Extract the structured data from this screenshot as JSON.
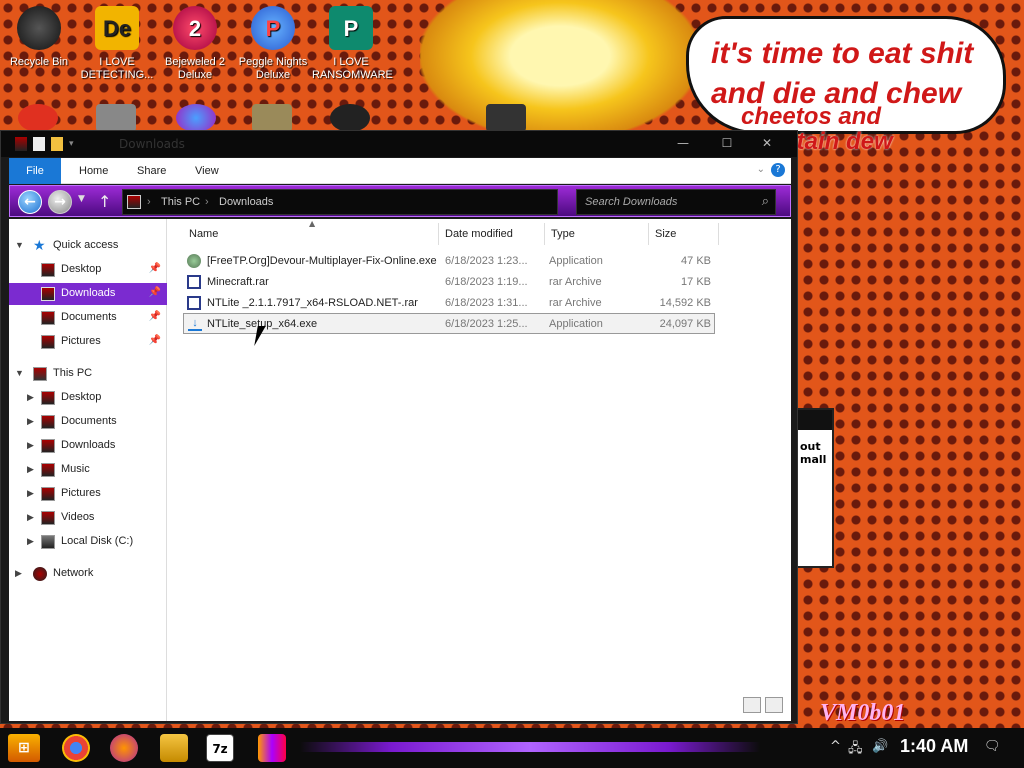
{
  "desktop": {
    "icons": [
      {
        "label": "Recycle Bin",
        "icon": "recycle-bin-icon"
      },
      {
        "label": "I LOVE DETECTING...",
        "icon": "de-icon"
      },
      {
        "label": "Bejeweled 2 Deluxe",
        "icon": "bejeweled-icon"
      },
      {
        "label": "Peggle Nights Deluxe",
        "icon": "peggle-icon"
      },
      {
        "label": "I LOVE RANSOMWARE",
        "icon": "publisher-icon"
      }
    ],
    "speech_bubble": {
      "line1": "it's time to eat shit",
      "line2": "and die and chew",
      "line3": "cheetos and",
      "line4": "ntain dew"
    },
    "bg_window_text": "out\nmall",
    "watermark": "VM0b01"
  },
  "explorer": {
    "title": "Downloads",
    "window_buttons": {
      "minimize": "—",
      "maximize": "☐",
      "close": "✕"
    },
    "ribbon_tabs": [
      "File",
      "Home",
      "Share",
      "View"
    ],
    "address": {
      "crumbs": [
        "This PC",
        "Downloads"
      ],
      "search_placeholder": "Search Downloads"
    },
    "nav_pane": {
      "quick_access": "Quick access",
      "quick_items": [
        "Desktop",
        "Downloads",
        "Documents",
        "Pictures"
      ],
      "this_pc": "This PC",
      "pc_items": [
        "Desktop",
        "Documents",
        "Downloads",
        "Music",
        "Pictures",
        "Videos",
        "Local Disk (C:)"
      ],
      "network": "Network"
    },
    "columns": [
      "Name",
      "Date modified",
      "Type",
      "Size"
    ],
    "files": [
      {
        "name": "[FreeTP.Org]Devour-Multiplayer-Fix-Online.exe",
        "date": "6/18/2023 1:23...",
        "type": "Application",
        "size": "47 KB"
      },
      {
        "name": "Minecraft.rar",
        "date": "6/18/2023 1:19...",
        "type": "rar Archive",
        "size": "17 KB"
      },
      {
        "name": "NTLite _2.1.1.7917_x64-RSLOAD.NET-.rar",
        "date": "6/18/2023 1:31...",
        "type": "rar Archive",
        "size": "14,592 KB"
      },
      {
        "name": "NTLite_setup_x64.exe",
        "date": "6/18/2023 1:25...",
        "type": "Application",
        "size": "24,097 KB"
      }
    ]
  },
  "taskbar": {
    "clock": "1:40 AM"
  }
}
